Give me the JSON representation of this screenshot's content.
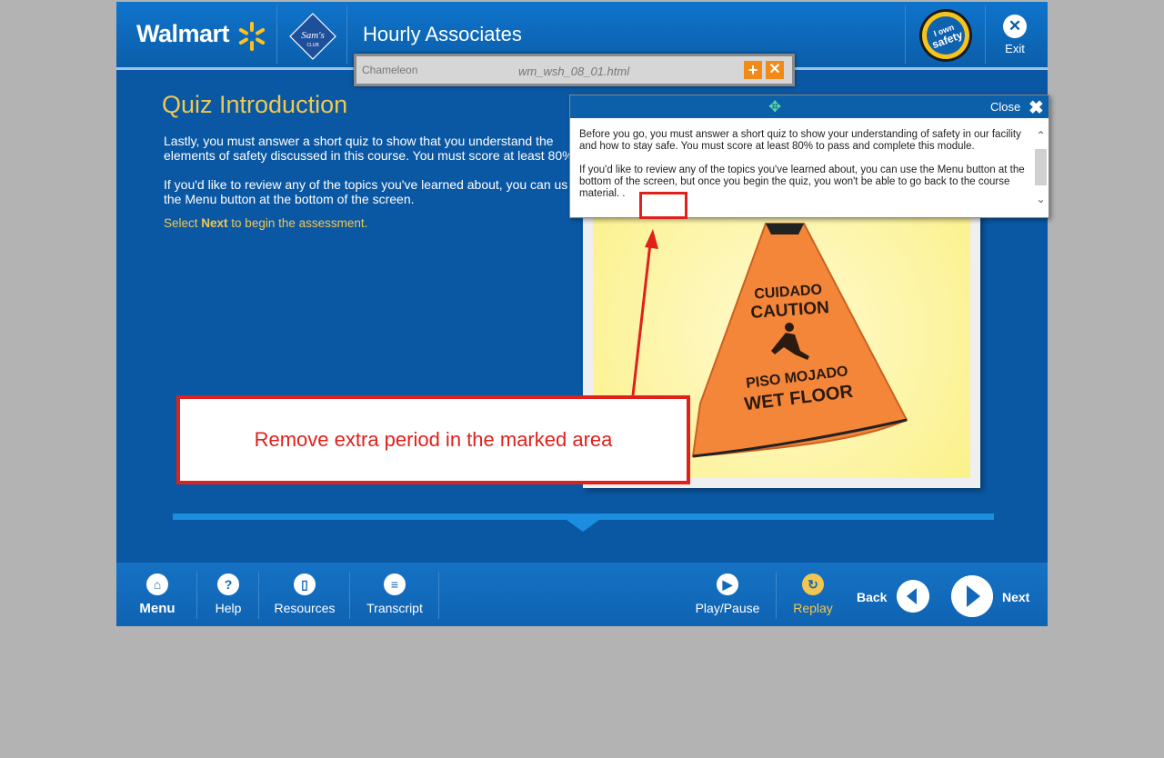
{
  "header": {
    "brand": "Walmart",
    "sams_logo_text": "Sam's CLUB",
    "course_title": "Hourly Associates",
    "badge_text": "I own safety",
    "exit_label": "Exit"
  },
  "chameleon": {
    "logo_text": "Chameleon",
    "file_name": "wm_wsh_08_01.html",
    "plus": "+",
    "close": "✕"
  },
  "slide": {
    "title": "Quiz Introduction",
    "para1": "Lastly, you must answer a short quiz to show that you understand the elements of safety discussed in this course.  You must score at least 80%",
    "para2": "If you'd like to review any of the topics you've learned about, you can us the Menu button at the bottom of the screen.",
    "select_prefix": "Select ",
    "select_bold": "Next",
    "select_suffix": " to begin the assessment."
  },
  "image": {
    "line1": "CUIDADO",
    "line2": "CAUTION",
    "line3": "PISO MOJADO",
    "line4": "WET FLOOR"
  },
  "popup": {
    "move_icon": "✥",
    "close_label": "Close",
    "close_icon": "✖",
    "para1": "Before you go, you must answer a short quiz to show your understanding of safety in our facility and how to stay safe.  You must score at least 80% to pass and complete this module.",
    "para2": "If you'd like to review any of the topics you've learned about, you can use the Menu button at the bottom of the screen, but once you begin the quiz, you won't be able to go back to the course material. .",
    "scroll_up": "⌃",
    "scroll_down": "⌄"
  },
  "annotation": {
    "note": "Remove extra period in the marked area",
    "color": "#e0201b"
  },
  "footer": {
    "menu": "Menu",
    "help": "Help",
    "resources": "Resources",
    "transcript": "Transcript",
    "play_pause": "Play/Pause",
    "replay": "Replay",
    "back": "Back",
    "next": "Next"
  },
  "icons": {
    "menu": "home-icon",
    "help": "question-icon",
    "resources": "document-icon",
    "transcript": "list-icon",
    "play_pause": "play-icon",
    "replay": "replay-icon",
    "back": "back-arrow-icon",
    "next": "next-arrow-icon"
  },
  "colors": {
    "app_blue": "#0a58a4",
    "accent_yellow": "#f1c750",
    "chameleon_orange": "#f28a1a",
    "annotation_red": "#e0201b"
  }
}
